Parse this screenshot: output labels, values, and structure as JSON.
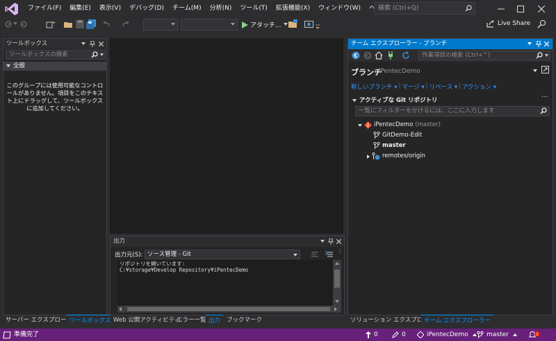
{
  "menu": {
    "items": [
      "ファイル(F)",
      "編集(E)",
      "表示(V)",
      "デバッグ(D)",
      "チーム(M)",
      "分析(N)",
      "ツール(T)",
      "拡張機能(X)",
      "ウィンドウ(W)",
      "ヘルプ(H)"
    ],
    "search_placeholder": "検索 (Ctrl+Q)"
  },
  "toolbar": {
    "attach_label": "アタッチ...",
    "live_share_label": "Live Share"
  },
  "toolbox": {
    "title": "ツールボックス",
    "search_placeholder": "ツールボックスの検索",
    "group_label": "全般",
    "empty_message": "このグループには使用可能なコントロールがありません。項目をこのテキスト上にドラッグして、ツールボックスに追加してください。"
  },
  "left_tabs": [
    "サーバー エクスプローラー",
    "ツールボックス"
  ],
  "team_explorer": {
    "title": "チーム エクスプローラー - ブランチ",
    "search_placeholder": "作業項目の検索 (Ctrl+^)",
    "page_title": "ブランチ",
    "repo_name_sub": "iPentecDemo",
    "links": [
      "新しいブランチ",
      "マージ",
      "リベース",
      "アクション"
    ],
    "section_title": "アクティブな Git リポジトリ",
    "filter_placeholder": "一覧にフィルターをかけるには、ここに入力します",
    "tree": {
      "repo": "iPentecDemo",
      "repo_branch": "(master)",
      "branches": [
        "GitDemo-Edit",
        "master"
      ],
      "remotes": "remotes/origin"
    }
  },
  "output": {
    "title": "出力",
    "source_label": "出力元(S):",
    "source_value": "ソース管理 - Git",
    "lines": [
      "リポジトリを開いています:",
      "C:¥storage¥Develop Repository¥iPentecDemo"
    ]
  },
  "bottom_tabs": [
    "Web 公開アクティビティ",
    "エラー一覧",
    "出力",
    "ブックマーク"
  ],
  "right_tabs": [
    "ソリューション エクスプローラー",
    "チーム エクスプローラー"
  ],
  "status": {
    "ready": "準備完了",
    "up_count": "0",
    "edit_count": "0",
    "repo": "iPentecDemo",
    "branch": "master",
    "notifications": "2"
  },
  "colors": {
    "accent": "#007acc",
    "statusbar": "#68217a",
    "link": "#3794ff",
    "git_orange": "#f05133"
  }
}
